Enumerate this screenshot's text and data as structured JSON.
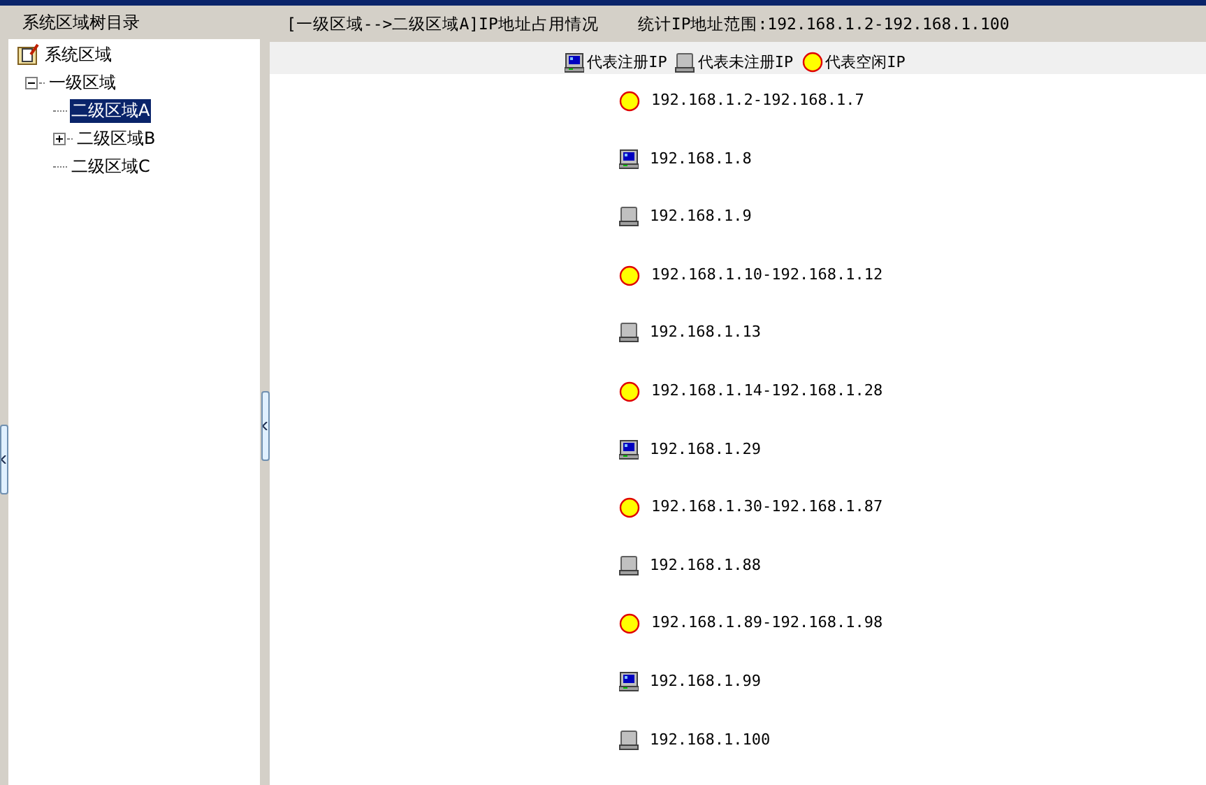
{
  "sidebar": {
    "title": "系统区域树目录",
    "tree": [
      {
        "label": "系统区域",
        "selected": false,
        "children": [
          {
            "label": "一级区域",
            "selected": false,
            "expanded": true,
            "children": [
              {
                "label": "二级区域A",
                "selected": true
              },
              {
                "label": "二级区域B",
                "selected": false,
                "expanded": false
              },
              {
                "label": "二级区域C",
                "selected": false
              }
            ]
          }
        ]
      }
    ]
  },
  "header": {
    "path": "[一级区域-->二级区域A]IP地址占用情况",
    "range": "统计IP地址范围:192.168.1.2-192.168.1.100"
  },
  "legend": [
    {
      "kind": "registered",
      "label": "代表注册IP"
    },
    {
      "kind": "unregistered",
      "label": "代表未注册IP"
    },
    {
      "kind": "free",
      "label": "代表空闲IP"
    }
  ],
  "ips": [
    {
      "kind": "free",
      "address": "192.168.1.2-192.168.1.7"
    },
    {
      "kind": "registered",
      "address": "192.168.1.8"
    },
    {
      "kind": "unregistered",
      "address": "192.168.1.9"
    },
    {
      "kind": "free",
      "address": "192.168.1.10-192.168.1.12"
    },
    {
      "kind": "unregistered",
      "address": "192.168.1.13"
    },
    {
      "kind": "free",
      "address": "192.168.1.14-192.168.1.28"
    },
    {
      "kind": "registered",
      "address": "192.168.1.29"
    },
    {
      "kind": "free",
      "address": "192.168.1.30-192.168.1.87"
    },
    {
      "kind": "unregistered",
      "address": "192.168.1.88"
    },
    {
      "kind": "free",
      "address": "192.168.1.89-192.168.1.98"
    },
    {
      "kind": "registered",
      "address": "192.168.1.99"
    },
    {
      "kind": "unregistered",
      "address": "192.168.1.100"
    }
  ]
}
